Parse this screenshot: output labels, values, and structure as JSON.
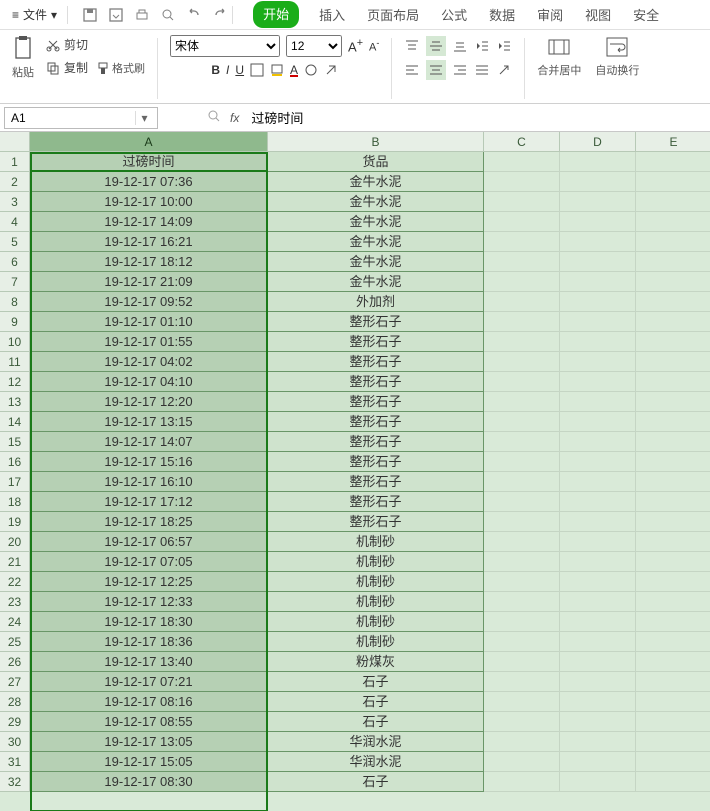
{
  "menubar": {
    "file_label": "文件",
    "tabs": [
      "开始",
      "插入",
      "页面布局",
      "公式",
      "数据",
      "审阅",
      "视图",
      "安全"
    ],
    "active_tab_index": 0
  },
  "ribbon": {
    "paste_label": "粘贴",
    "cut_label": "剪切",
    "copy_label": "复制",
    "format_painter_label": "格式刷",
    "font_name": "宋体",
    "font_size": "12",
    "merge_label": "合并居中",
    "wrap_label": "自动换行"
  },
  "namebox": {
    "value": "A1"
  },
  "formula": {
    "value": "过磅时间"
  },
  "columns": [
    {
      "letter": "A",
      "wclass": "wA",
      "selected": true
    },
    {
      "letter": "B",
      "wclass": "wB",
      "selected": false
    },
    {
      "letter": "C",
      "wclass": "wC",
      "selected": false
    },
    {
      "letter": "D",
      "wclass": "wD",
      "selected": false
    },
    {
      "letter": "E",
      "wclass": "wE",
      "selected": false
    }
  ],
  "visible_rows": 32,
  "chart_data": {
    "type": "table",
    "headers": [
      "过磅时间",
      "货品"
    ],
    "rows": [
      [
        "19-12-17 07:36",
        "金牛水泥"
      ],
      [
        "19-12-17 10:00",
        "金牛水泥"
      ],
      [
        "19-12-17 14:09",
        "金牛水泥"
      ],
      [
        "19-12-17 16:21",
        "金牛水泥"
      ],
      [
        "19-12-17 18:12",
        "金牛水泥"
      ],
      [
        "19-12-17 21:09",
        "金牛水泥"
      ],
      [
        "19-12-17 09:52",
        "外加剂"
      ],
      [
        "19-12-17 01:10",
        "整形石子"
      ],
      [
        "19-12-17 01:55",
        "整形石子"
      ],
      [
        "19-12-17 04:02",
        "整形石子"
      ],
      [
        "19-12-17 04:10",
        "整形石子"
      ],
      [
        "19-12-17 12:20",
        "整形石子"
      ],
      [
        "19-12-17 13:15",
        "整形石子"
      ],
      [
        "19-12-17 14:07",
        "整形石子"
      ],
      [
        "19-12-17 15:16",
        "整形石子"
      ],
      [
        "19-12-17 16:10",
        "整形石子"
      ],
      [
        "19-12-17 17:12",
        "整形石子"
      ],
      [
        "19-12-17 18:25",
        "整形石子"
      ],
      [
        "19-12-17 06:57",
        "机制砂"
      ],
      [
        "19-12-17 07:05",
        "机制砂"
      ],
      [
        "19-12-17 12:25",
        "机制砂"
      ],
      [
        "19-12-17 12:33",
        "机制砂"
      ],
      [
        "19-12-17 18:30",
        "机制砂"
      ],
      [
        "19-12-17 18:36",
        "机制砂"
      ],
      [
        "19-12-17 13:40",
        "粉煤灰"
      ],
      [
        "19-12-17 07:21",
        "石子"
      ],
      [
        "19-12-17 08:16",
        "石子"
      ],
      [
        "19-12-17 08:55",
        "石子"
      ],
      [
        "19-12-17 13:05",
        "华润水泥"
      ],
      [
        "19-12-17 15:05",
        "华润水泥"
      ],
      [
        "19-12-17 08:30",
        "石子"
      ]
    ]
  }
}
